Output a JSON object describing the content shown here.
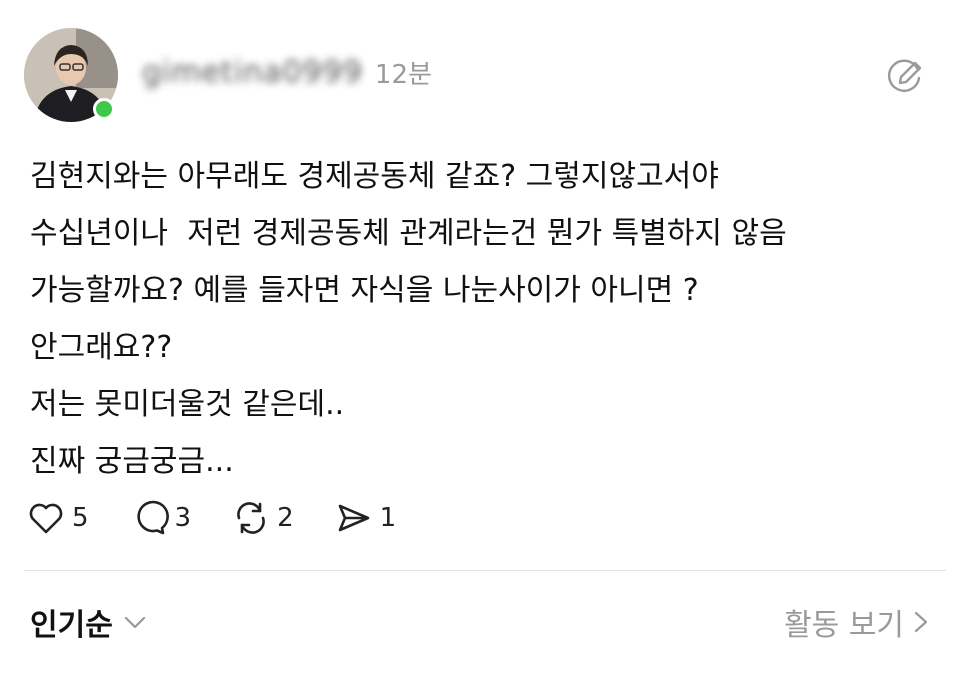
{
  "post": {
    "username": "gimetina0999",
    "time": "12분",
    "lines": [
      "김현지와는 아무래도 경제공동체 같죠? 그렇지않고서야",
      "수십년이나  저런 경제공동체 관계라는건 뭔가 특별하지 않음",
      "가능할까요? 예를 들자면 자식을 나눈사이가 아니면 ?",
      "안그래요??",
      "저는 못미더울것 같은데..",
      "진짜 궁금궁금..."
    ]
  },
  "actions": {
    "likes": "5",
    "comments": "3",
    "reposts": "2",
    "shares": "1"
  },
  "footer": {
    "sort_label": "인기순",
    "activity_label": "활동 보기"
  },
  "icons": {
    "like": "heart-icon",
    "comment": "speech-bubble-icon",
    "repost": "repost-icon",
    "share": "send-icon",
    "edit": "edit-icon",
    "sort": "chevron-down-icon",
    "activity": "chevron-right-icon"
  },
  "colors": {
    "online": "#3ec74a",
    "muted": "#9a9a9a",
    "text": "#111111"
  }
}
